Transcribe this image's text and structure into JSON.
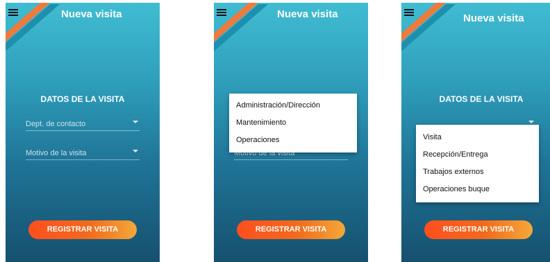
{
  "screens": [
    {
      "title": "Nueva visita",
      "section_title": "DATOS DE LA VISITA",
      "dept_field": {
        "label": "Dept. de contacto"
      },
      "motivo_field": {
        "label": "Motivo de la visita"
      },
      "register_button": "REGISTRAR VISITA"
    },
    {
      "title": "Nueva visita",
      "motivo_field": {
        "label": "Motivo de la visita"
      },
      "register_button": "REGISTRAR VISITA",
      "dropdown": {
        "options": [
          "Administración/Dirección",
          "Mantenimiento",
          "Operaciones"
        ]
      }
    },
    {
      "title": "Nueva visita",
      "section_title": "DATOS DE LA VISITA",
      "register_button": "REGISTRAR VISITA",
      "dropdown": {
        "options": [
          "Visita",
          "Recepción/Entrega",
          "Trabajos externos",
          "Operaciones buque"
        ]
      }
    }
  ],
  "colors": {
    "gradient_top": "#40bcd2",
    "gradient_bottom": "#16506f",
    "button_start": "#ff4f1f",
    "button_end": "#f4a83a",
    "stripe_orange": "#f07a3c",
    "stripe_teal": "#1f8fae"
  }
}
